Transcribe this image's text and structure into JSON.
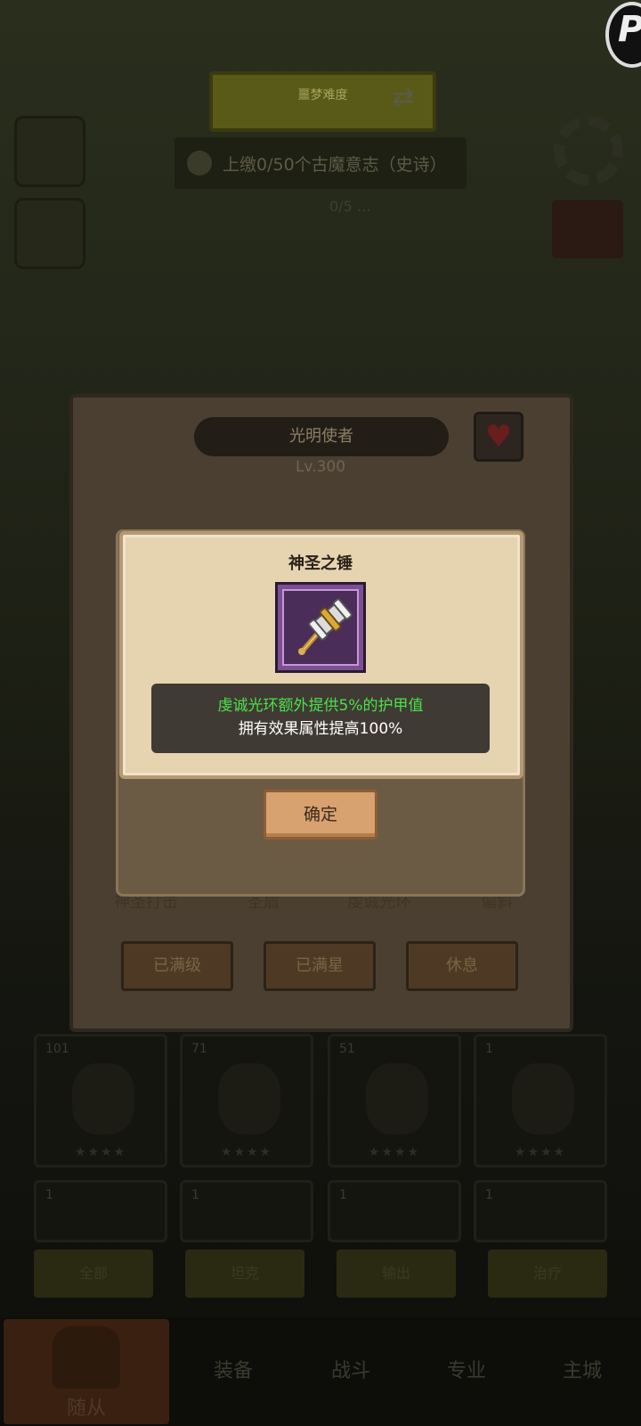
{
  "background": {
    "banner_text": "噩梦难度",
    "quest_text": "上缴0/50个古魔意志（史诗）",
    "quest_sub": "0/5  …",
    "hero": {
      "name": "光明使者",
      "level": "Lv.300",
      "skills": [
        "神圣打击",
        "圣盾",
        "虔诚光环",
        "偏斜"
      ],
      "buttons": [
        "已满级",
        "已满星",
        "休息"
      ]
    },
    "roster": [
      {
        "num": "101",
        "stars": "★★★★"
      },
      {
        "num": "71",
        "stars": "★★★★"
      },
      {
        "num": "51",
        "stars": "★★★★"
      },
      {
        "num": "1",
        "stars": "★★★★"
      }
    ],
    "roster_row2": [
      "1",
      "1",
      "1",
      "1"
    ],
    "filters": [
      "全部",
      "坦克",
      "输出",
      "治疗"
    ],
    "nav": {
      "active": "随从",
      "items": [
        "装备",
        "战斗",
        "专业",
        "主城"
      ]
    }
  },
  "modal": {
    "title": "神圣之锤",
    "item_icon": "holy-hammer-icon",
    "rarity_color": "#7c4f93",
    "desc_line1": "虔诚光环额外提供5%的护甲值",
    "desc_line2": "拥有效果属性提高100%",
    "confirm_label": "确定"
  },
  "colors": {
    "highlight_green": "#4de04a",
    "paper": "#e6d3b0",
    "button": "#d7a170"
  }
}
